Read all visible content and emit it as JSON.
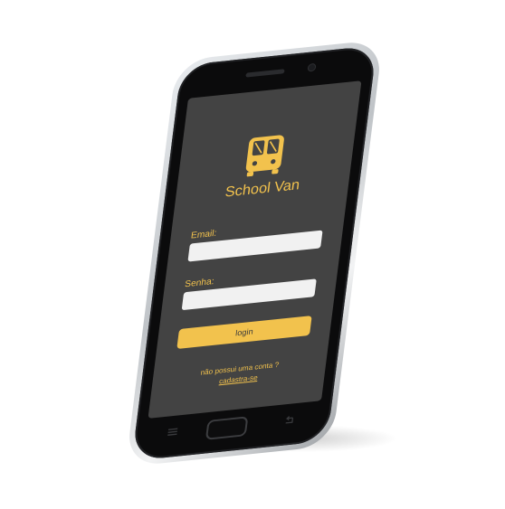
{
  "app": {
    "title": "School Van",
    "logo_icon": "school-bus-icon",
    "accent_color": "#f2c24d",
    "screen_color": "#434343"
  },
  "form": {
    "email_label": "Email:",
    "email_value": "",
    "senha_label": "Senha:",
    "senha_value": "",
    "login_label": "login"
  },
  "footer": {
    "prompt": "não possui uma conta ?",
    "signup_link": "cadastra-se"
  },
  "device": {
    "nav_icons": [
      "menu-icon",
      "back-icon"
    ]
  }
}
